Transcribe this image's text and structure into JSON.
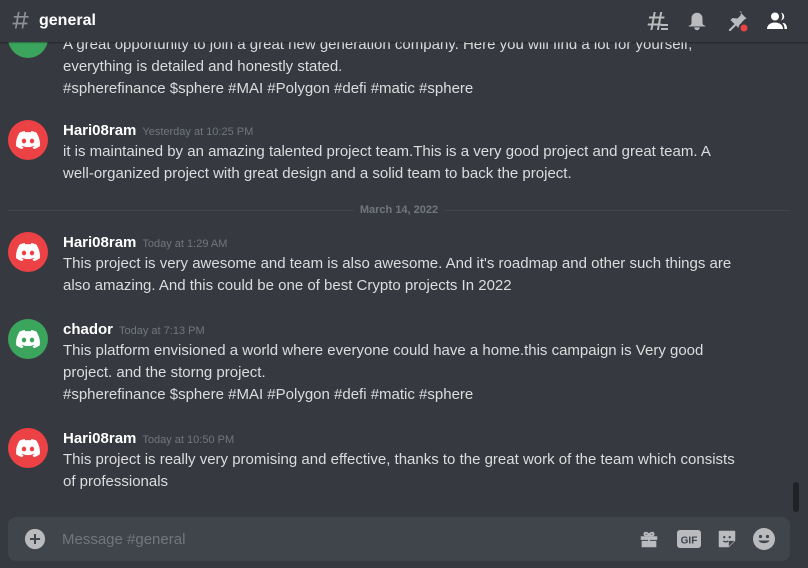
{
  "header": {
    "channel_name": "general",
    "icons": [
      "hash-icon",
      "threads-icon",
      "notification-bell-icon",
      "pinned-messages-icon",
      "member-list-icon"
    ]
  },
  "colors": {
    "background": "#36393f",
    "composer": "#40444b",
    "avatar_red": "#ed4245",
    "avatar_green": "#3ba55d",
    "mention_dot": "#ed4245",
    "text": "#dcddde",
    "muted": "#72767d"
  },
  "messages": [
    {
      "continued": true,
      "lines": [
        "A great opportunity to join a great new generation company. Here you will find a lot for yourself,",
        "everything is detailed and honestly stated.",
        "#spherefinance $sphere #MAI #Polygon #defi #matic #sphere"
      ]
    },
    {
      "username": "Hari08ram",
      "timestamp": "Yesterday at 10:25 PM",
      "avatar": "discord-logo-icon",
      "lines": [
        "it is maintained by an amazing talented project team.This is a very good project and great team. A",
        "well-organized project with great design and a solid team to back the project."
      ]
    },
    {
      "username": "Hari08ram",
      "timestamp": "Today at 1:29 AM",
      "avatar": "discord-logo-icon",
      "lines": [
        "This project is very awesome and team is also awesome. And it's roadmap and other such things are",
        "also amazing. And this could be one of best Crypto projects In 2022"
      ]
    },
    {
      "username": "chador",
      "timestamp": "Today at 7:13 PM",
      "avatar": "discord-logo-icon",
      "lines": [
        "This platform envisioned a world where everyone could have a home.this campaign is Very good",
        "project. and the storng project.",
        "#spherefinance $sphere #MAI #Polygon #defi #matic #sphere"
      ]
    },
    {
      "username": "Hari08ram",
      "timestamp": "Today at 10:50 PM",
      "avatar": "discord-logo-icon",
      "lines": [
        "This project is really very promising and effective, thanks to the great work of the team which consists",
        "of professionals"
      ]
    }
  ],
  "date_divider": "March 14, 2022",
  "composer": {
    "placeholder": "Message #general",
    "value": "",
    "gif_label": "GIF",
    "icons": [
      "add-attachment-icon",
      "gift-icon",
      "gif-icon",
      "sticker-icon",
      "emoji-icon"
    ]
  }
}
